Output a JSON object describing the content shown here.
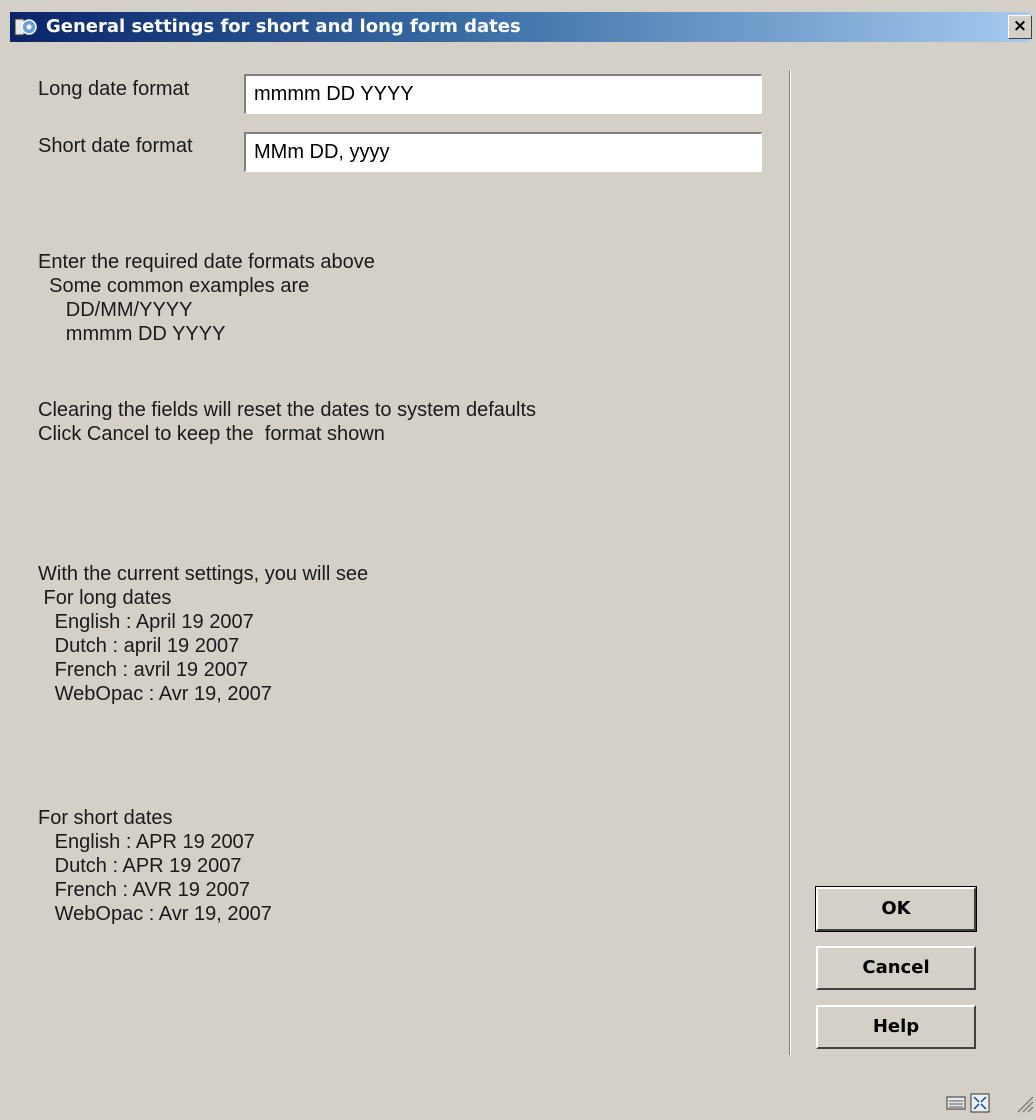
{
  "window": {
    "title": "General settings for short and long form dates",
    "close_glyph": "×"
  },
  "form": {
    "long_label": "Long date format",
    "long_value": "mmmm DD YYYY",
    "short_label": "Short date format",
    "short_value": "MMm DD, yyyy"
  },
  "instructions": {
    "lines": [
      "Enter the required date formats above",
      "  Some common examples are",
      "     DD/MM/YYYY",
      "     mmmm DD YYYY"
    ]
  },
  "notes": {
    "lines": [
      "Clearing the fields will reset the dates to system defaults",
      "Click Cancel to keep the  format shown"
    ]
  },
  "preview_long": {
    "lines": [
      "With the current settings, you will see",
      " For long dates",
      "   English : April 19 2007",
      "   Dutch : april 19 2007",
      "   French : avril 19 2007",
      "   WebOpac : Avr 19, 2007"
    ]
  },
  "preview_short": {
    "lines": [
      "For short dates",
      "   English : APR 19 2007",
      "   Dutch : APR 19 2007",
      "   French : AVR 19 2007",
      "   WebOpac : Avr 19, 2007"
    ]
  },
  "buttons": {
    "ok": "OK",
    "cancel": "Cancel",
    "help": "Help"
  },
  "icons": {
    "app": "app-icon",
    "status": [
      "keyboard-icon",
      "fullscreen-icon",
      "resize-grip-icon"
    ]
  },
  "colors": {
    "titlebar_start": "#0a246a",
    "titlebar_end": "#a6caf0",
    "dialog_bg": "#d4d0c8"
  }
}
